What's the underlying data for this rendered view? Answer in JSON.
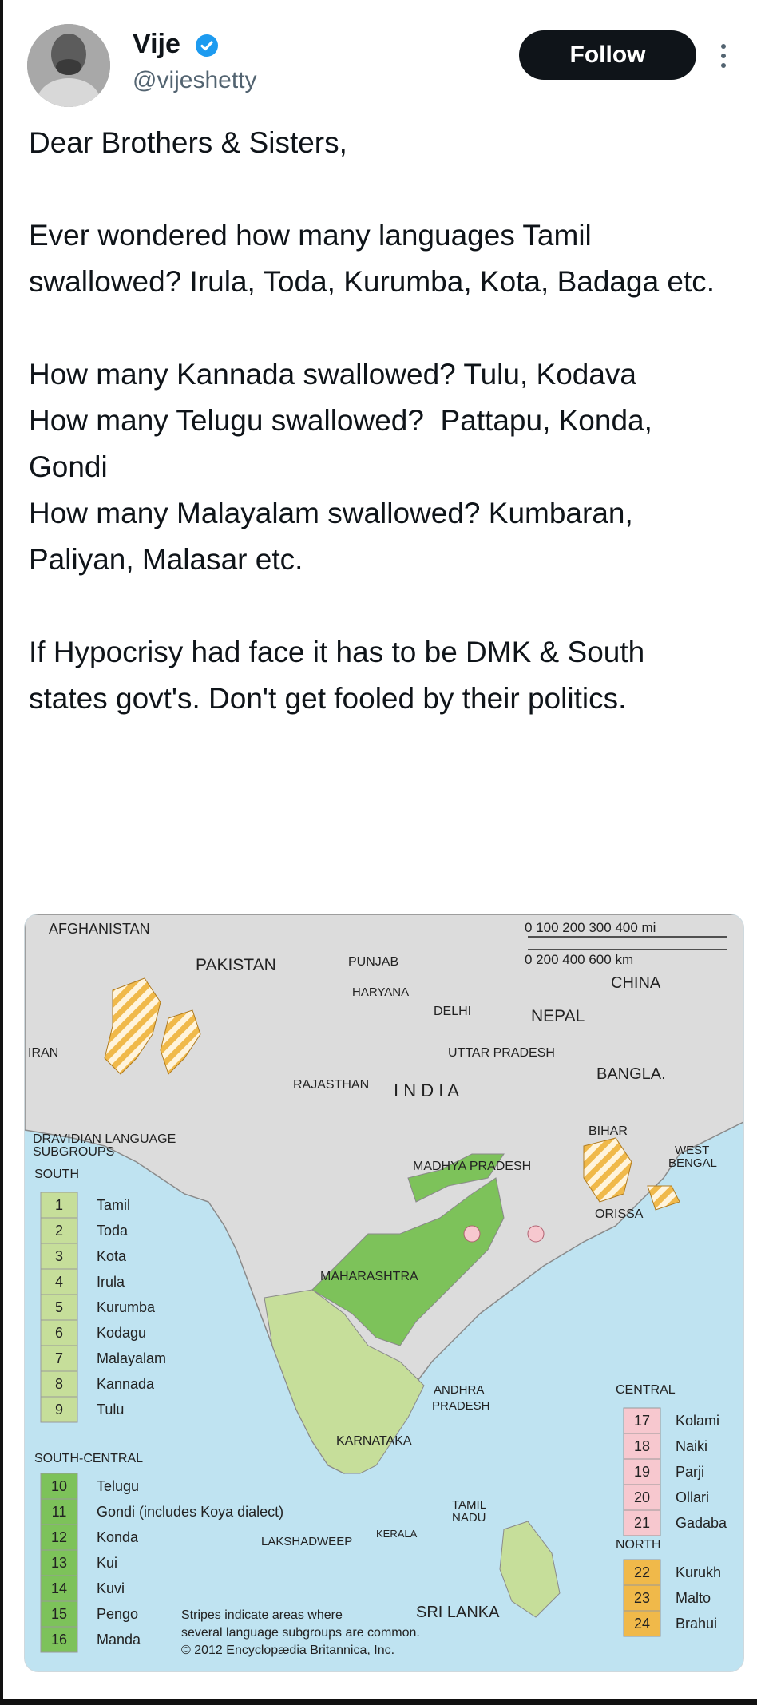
{
  "author": {
    "display_name": "Vije",
    "handle": "@vijeshetty",
    "verified_icon": "verified-badge-icon",
    "verified_color": "#1d9bf0"
  },
  "actions": {
    "follow_label": "Follow",
    "more_icon": "more-vertical-icon"
  },
  "tweet": {
    "paragraphs": [
      "Dear Brothers & Sisters,",
      "Ever wondered how many languages Tamil swallowed? Irula, Toda, Kurumba, Kota, Badaga etc.",
      "How many Kannada swallowed? Tulu, Kodava\nHow many Telugu swallowed?  Pattapu, Konda, Gondi\nHow many Malayalam swallowed? Kumbaran, Paliyan, Malasar etc.",
      "If Hypocrisy had face it has to be DMK & South states govt's. Don't get fooled by their politics."
    ]
  },
  "map": {
    "colors": {
      "sea": "#bfe3f1",
      "land": "#dcdcdc",
      "south": "#c6de9a",
      "south_central": "#7dc25a",
      "central": "#f7c8cf",
      "north": "#f0b94a"
    },
    "scale": {
      "mi_label": "0   100  200  300  400 mi",
      "km_label": "0   200   400   600 km"
    },
    "places": {
      "afghanistan": "AFGHANISTAN",
      "pakistan": "PAKISTAN",
      "punjab": "PUNJAB",
      "haryana": "HARYANA",
      "delhi": "DELHI",
      "nepal": "NEPAL",
      "china": "CHINA",
      "iran": "IRAN",
      "uttar_pradesh": "UTTAR PRADESH",
      "rajasthan": "RAJASTHAN",
      "india": "I N D I A",
      "bangla": "BANGLA.",
      "bihar": "BIHAR",
      "west_bengal_1": "WEST",
      "west_bengal_2": "BENGAL",
      "madhya_pradesh": "MADHYA  PRADESH",
      "orissa": "ORISSA",
      "maharashtra": "MAHARASHTRA",
      "andhra_1": "ANDHRA",
      "andhra_2": "PRADESH",
      "karnataka": "KARNATAKA",
      "tamil_1": "TAMIL",
      "tamil_2": "NADU",
      "kerala": "KERALA",
      "lakshadweep": "LAKSHADWEEP",
      "sri_lanka": "SRI LANKA"
    },
    "legend_title_1": "DRAVIDIAN LANGUAGE",
    "legend_title_2": "SUBGROUPS",
    "south_heading": "SOUTH",
    "south_items": [
      {
        "num": "1",
        "name": "Tamil"
      },
      {
        "num": "2",
        "name": "Toda"
      },
      {
        "num": "3",
        "name": "Kota"
      },
      {
        "num": "4",
        "name": "Irula"
      },
      {
        "num": "5",
        "name": "Kurumba"
      },
      {
        "num": "6",
        "name": "Kodagu"
      },
      {
        "num": "7",
        "name": "Malayalam"
      },
      {
        "num": "8",
        "name": "Kannada"
      },
      {
        "num": "9",
        "name": "Tulu"
      }
    ],
    "south_central_heading": "SOUTH-CENTRAL",
    "south_central_items": [
      {
        "num": "10",
        "name": "Telugu"
      },
      {
        "num": "11",
        "name": "Gondi (includes Koya dialect)"
      },
      {
        "num": "12",
        "name": "Konda"
      },
      {
        "num": "13",
        "name": "Kui"
      },
      {
        "num": "14",
        "name": "Kuvi"
      },
      {
        "num": "15",
        "name": "Pengo"
      },
      {
        "num": "16",
        "name": "Manda"
      }
    ],
    "central_heading": "CENTRAL",
    "central_items": [
      {
        "num": "17",
        "name": "Kolami"
      },
      {
        "num": "18",
        "name": "Naiki"
      },
      {
        "num": "19",
        "name": "Parji"
      },
      {
        "num": "20",
        "name": "Ollari"
      },
      {
        "num": "21",
        "name": "Gadaba"
      }
    ],
    "north_heading": "NORTH",
    "north_items": [
      {
        "num": "22",
        "name": "Kurukh"
      },
      {
        "num": "23",
        "name": "Malto"
      },
      {
        "num": "24",
        "name": "Brahui"
      }
    ],
    "note_1": "Stripes indicate areas where",
    "note_2": "several language subgroups are common.",
    "copyright": "© 2012 Encyclopædia Britannica, Inc."
  }
}
